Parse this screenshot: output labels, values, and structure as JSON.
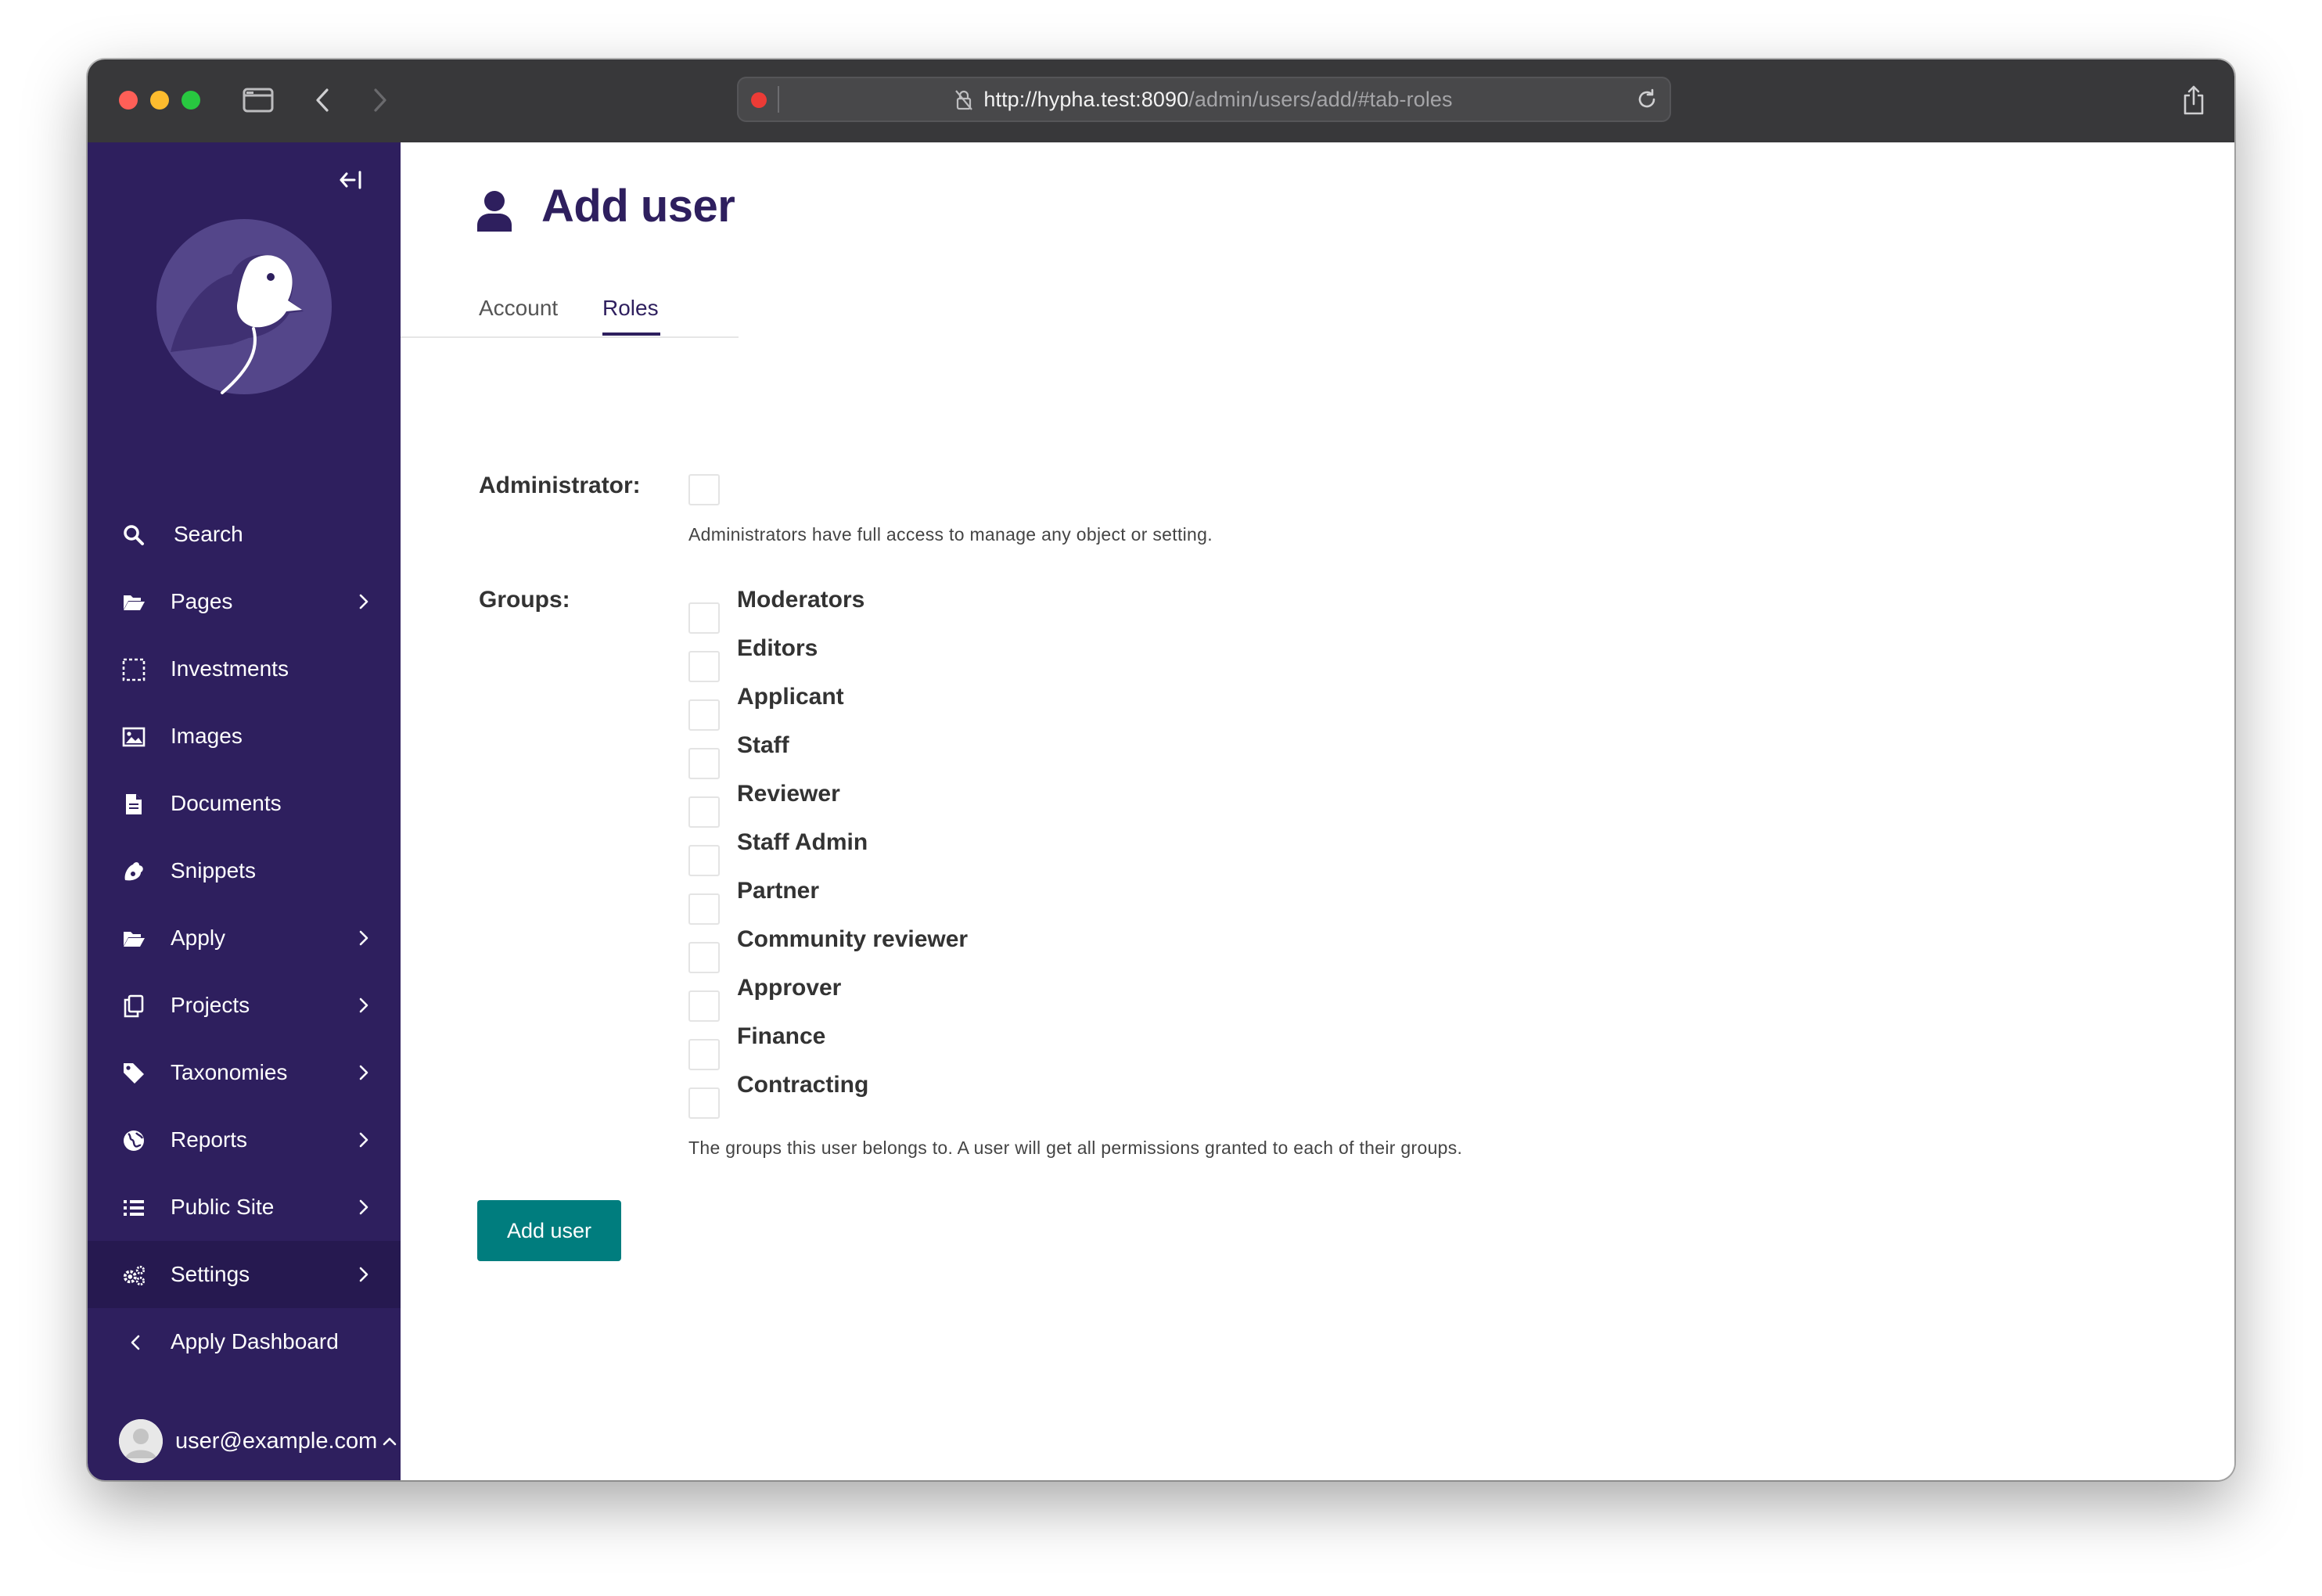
{
  "browser": {
    "url_host": "http://hypha.test:8090",
    "url_path": "/admin/users/add/#tab-roles"
  },
  "sidebar": {
    "items": [
      {
        "label": "Search",
        "icon": "search-icon"
      },
      {
        "label": "Pages",
        "icon": "folder-open-icon"
      },
      {
        "label": "Investments",
        "icon": "dashed-square-icon"
      },
      {
        "label": "Images",
        "icon": "image-icon"
      },
      {
        "label": "Documents",
        "icon": "document-icon"
      },
      {
        "label": "Snippets",
        "icon": "puzzle-icon"
      },
      {
        "label": "Apply",
        "icon": "folder-open-icon"
      },
      {
        "label": "Projects",
        "icon": "copy-icon"
      },
      {
        "label": "Taxonomies",
        "icon": "tag-icon"
      },
      {
        "label": "Reports",
        "icon": "globe-icon"
      },
      {
        "label": "Public Site",
        "icon": "list-icon"
      },
      {
        "label": "Settings",
        "icon": "cogs-icon"
      },
      {
        "label": "Apply Dashboard",
        "icon": "chevron-left-icon"
      }
    ],
    "user_email": "user@example.com"
  },
  "page": {
    "title": "Add user",
    "tabs": [
      "Account",
      "Roles"
    ],
    "active_tab": "Roles"
  },
  "form": {
    "administrator_label": "Administrator:",
    "administrator_help": "Administrators have full access to manage any object or setting.",
    "groups_label": "Groups:",
    "groups": [
      "Moderators",
      "Editors",
      "Applicant",
      "Staff",
      "Reviewer",
      "Staff Admin",
      "Partner",
      "Community reviewer",
      "Approver",
      "Finance",
      "Contracting"
    ],
    "groups_help": "The groups this user belongs to. A user will get all permissions granted to each of their groups.",
    "submit_label": "Add user"
  },
  "colors": {
    "sidebar_bg": "#2e1f5e",
    "accent_teal": "#007d7e",
    "title_color": "#2e1f5e"
  }
}
